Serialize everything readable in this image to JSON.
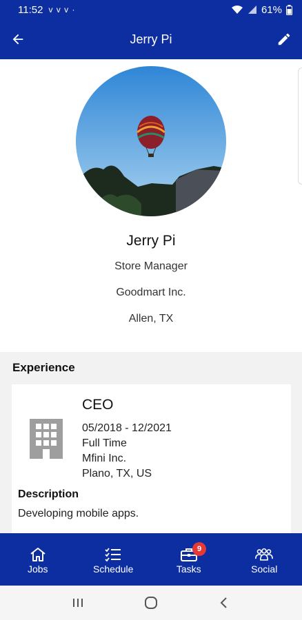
{
  "status_bar": {
    "time": "11:52",
    "notification_icons": "v v v ·",
    "battery": "61%"
  },
  "app_bar": {
    "title": "Jerry Pi",
    "back_icon": "arrow-left-icon",
    "edit_icon": "pencil-icon"
  },
  "profile": {
    "name": "Jerry Pi",
    "role": "Store Manager",
    "company": "Goodmart Inc.",
    "location": "Allen, TX"
  },
  "experience": {
    "section_title": "Experience",
    "items": [
      {
        "title": "CEO",
        "dates": "05/2018 - 12/2021",
        "type": "Full Time",
        "company": "Mfini Inc.",
        "location": "Plano, TX, US",
        "description_label": "Description",
        "description": "Developing mobile apps."
      }
    ]
  },
  "bottom_nav": {
    "items": [
      {
        "label": "Jobs",
        "icon": "home-icon"
      },
      {
        "label": "Schedule",
        "icon": "checklist-icon"
      },
      {
        "label": "Tasks",
        "icon": "briefcase-icon",
        "badge": "9"
      },
      {
        "label": "Social",
        "icon": "people-icon"
      }
    ]
  },
  "colors": {
    "primary": "#0d2ea0",
    "badge": "#e53935",
    "section_bg": "#f2f2f2"
  }
}
